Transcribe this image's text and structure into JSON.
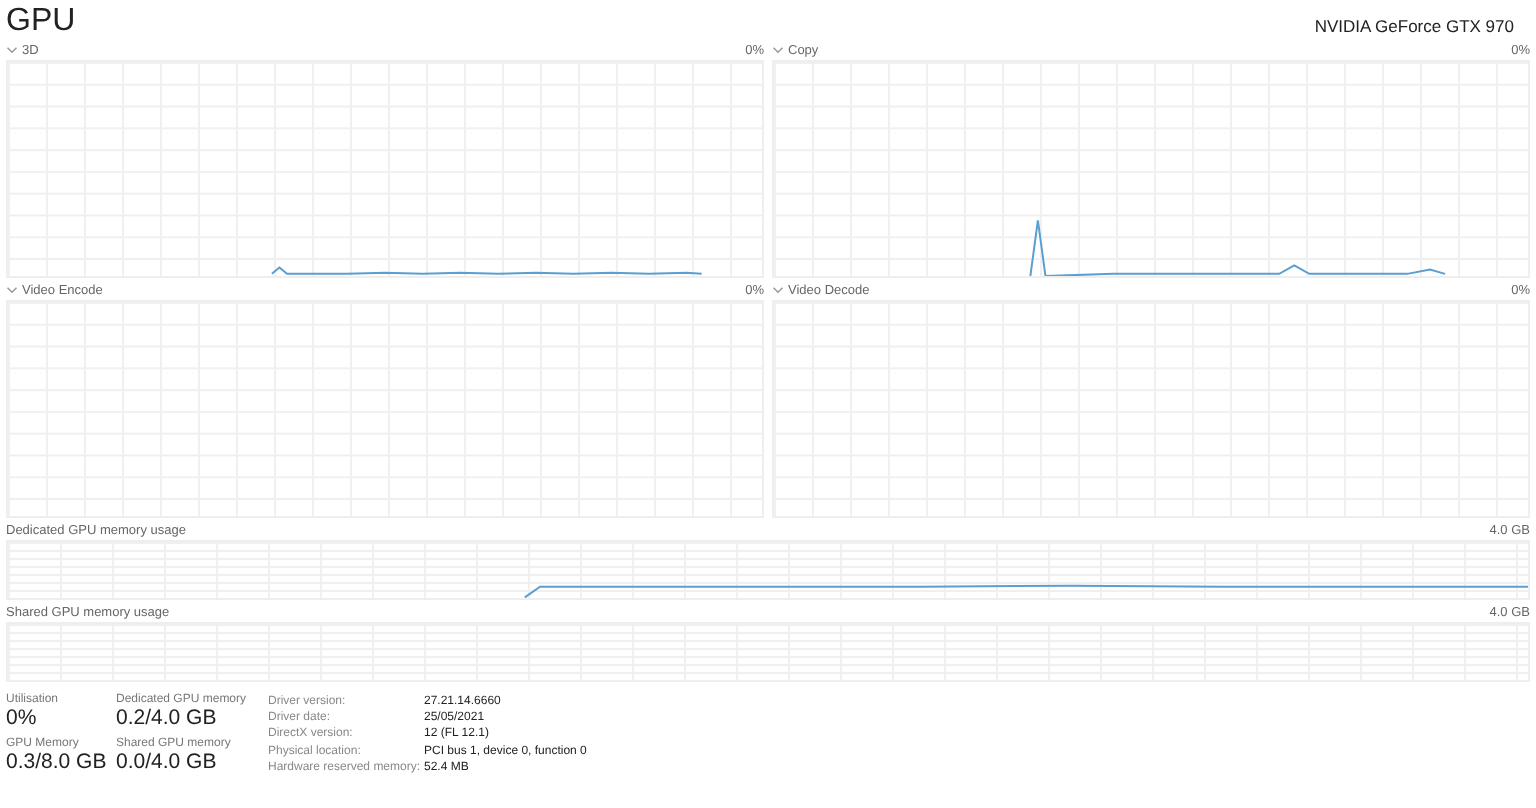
{
  "window": {
    "title": "GPU",
    "device": "NVIDIA GeForce GTX 970"
  },
  "engine_graphs": [
    {
      "label": "3D",
      "max": "0%"
    },
    {
      "label": "Copy",
      "max": "0%"
    },
    {
      "label": "Video Encode",
      "max": "0%"
    },
    {
      "label": "Video Decode",
      "max": "0%"
    }
  ],
  "memory_graphs": [
    {
      "label": "Dedicated GPU memory usage",
      "max": "4.0 GB"
    },
    {
      "label": "Shared GPU memory usage",
      "max": "4.0 GB"
    }
  ],
  "stats": [
    {
      "label": "Utilisation",
      "value": "0%"
    },
    {
      "label": "Dedicated GPU memory",
      "value": "0.2/4.0 GB"
    },
    {
      "label": "GPU Memory",
      "value": "0.3/8.0 GB"
    },
    {
      "label": "Shared GPU memory",
      "value": "0.0/4.0 GB"
    }
  ],
  "details": [
    {
      "label": "Driver version:",
      "value": "27.21.14.6660"
    },
    {
      "label": "Driver date:",
      "value": "25/05/2021"
    },
    {
      "label": "DirectX version:",
      "value": "12 (FL 12.1)"
    },
    {
      "label": "Physical location:",
      "value": "PCI bus 1, device 0, function 0"
    },
    {
      "label": "Hardware reserved memory:",
      "value": "52.4 MB"
    }
  ]
}
